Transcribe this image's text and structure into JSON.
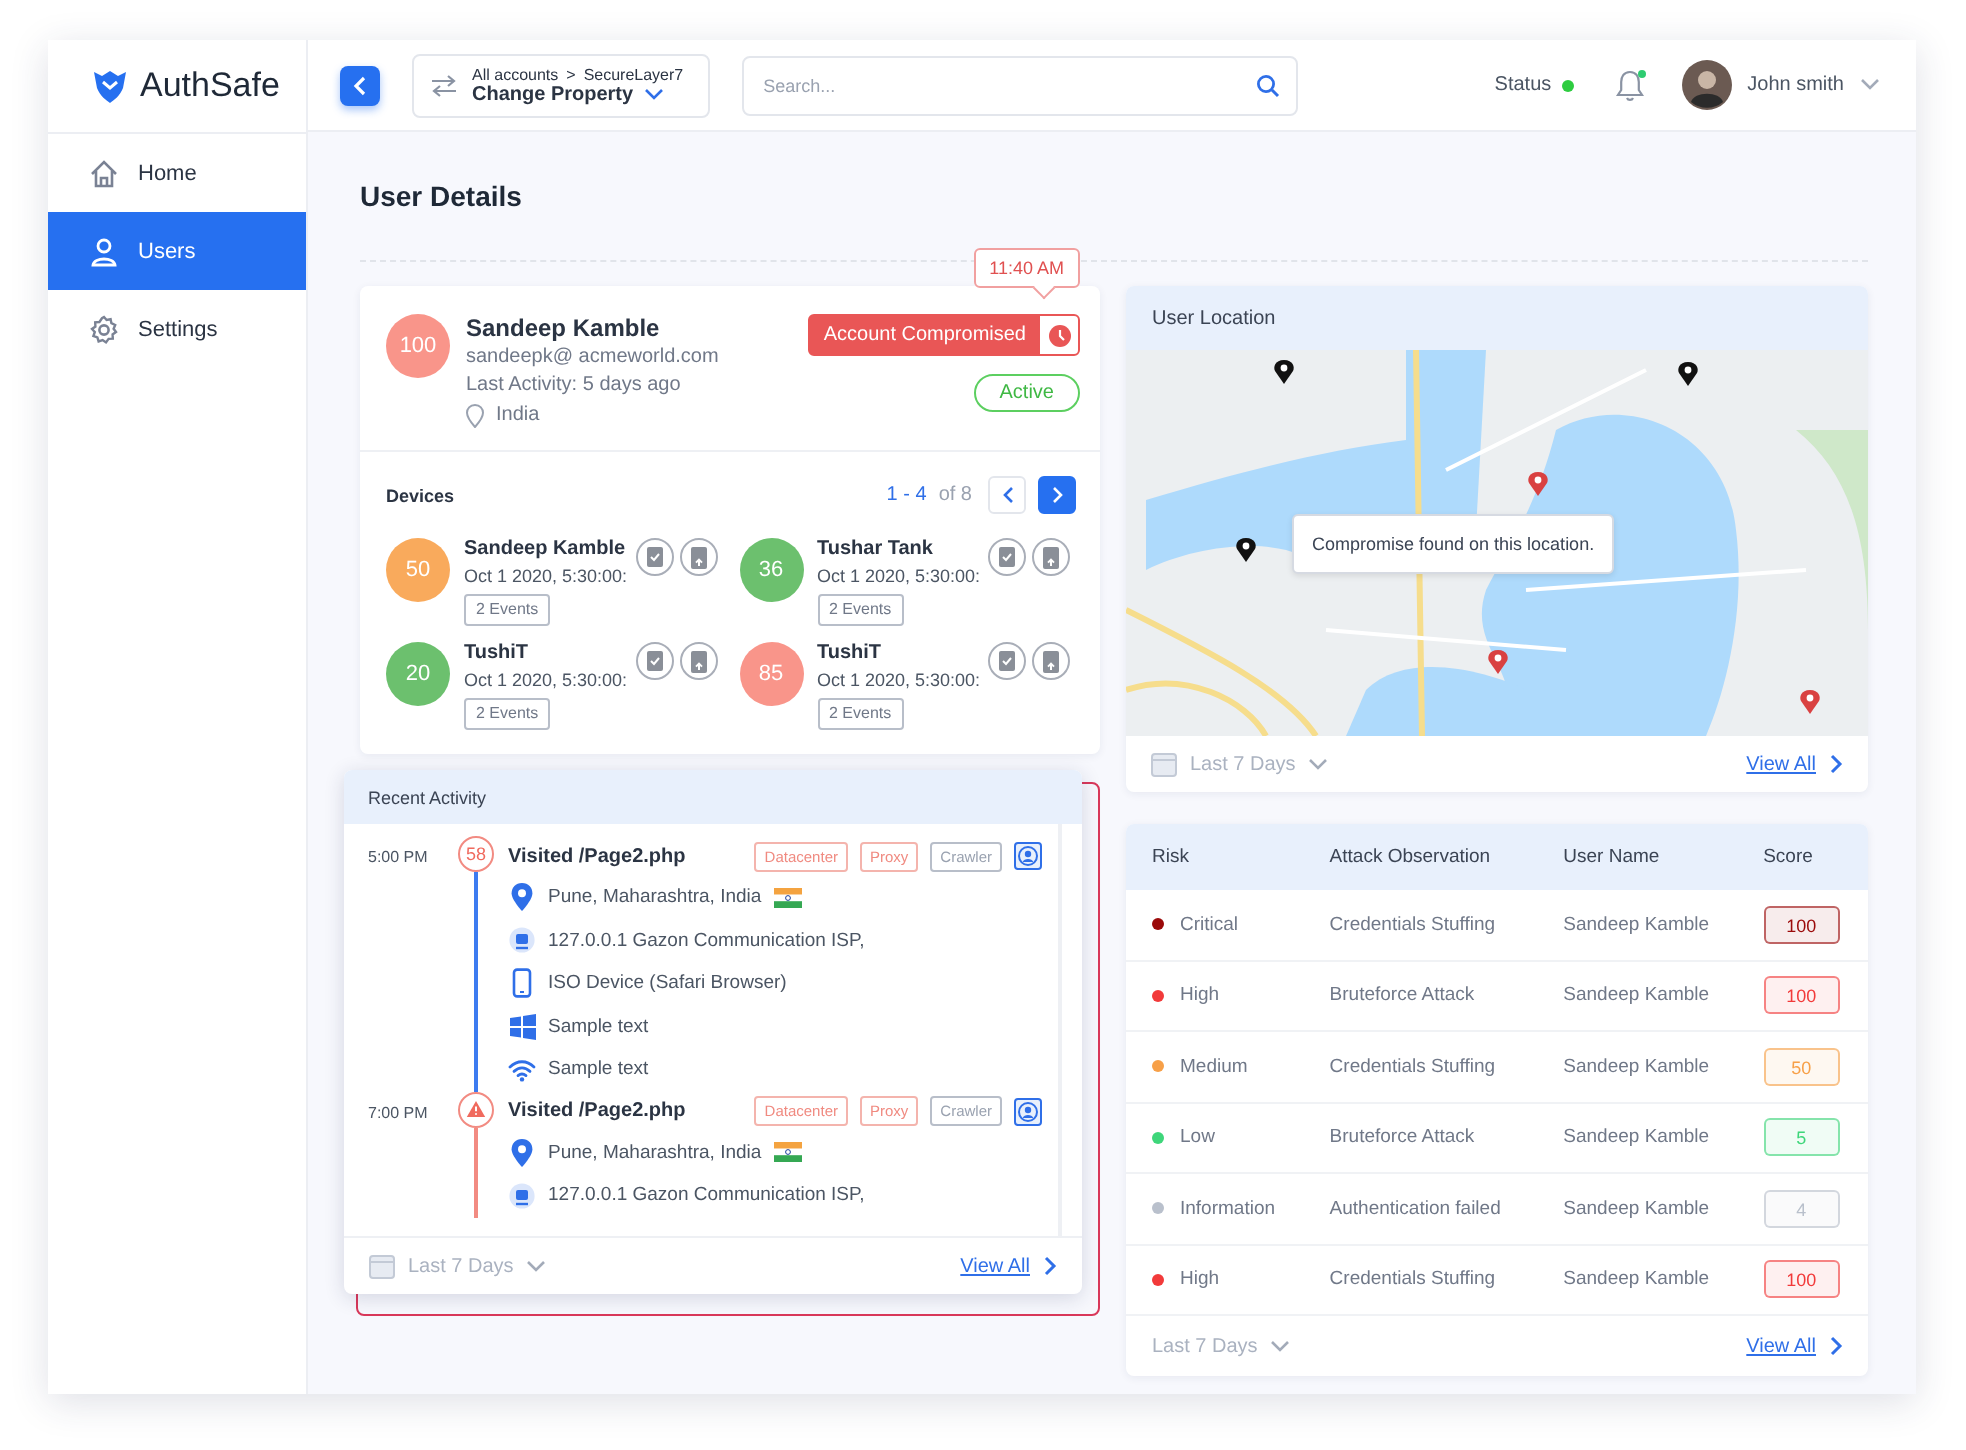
{
  "brand": {
    "name": "AuthSafe"
  },
  "sidebar": {
    "items": [
      {
        "label": "Home",
        "kind": "home",
        "selected": false
      },
      {
        "label": "Users",
        "kind": "user",
        "selected": true
      },
      {
        "label": "Settings",
        "kind": "settings",
        "selected": false
      }
    ]
  },
  "header": {
    "breadcrumb": {
      "parent": "All accounts",
      "separator": ">",
      "child": "SecureLayer7",
      "current": "Change Property"
    },
    "search": {
      "placeholder": "Search..."
    },
    "status": {
      "label": "Status",
      "online": true
    },
    "notifications": {
      "unread": true
    },
    "user": {
      "name": "John smith"
    }
  },
  "page_title": "User Details",
  "user_card": {
    "score": "100",
    "color": "#f9958a",
    "name": "Sandeep Kamble",
    "email": "sandeepk@ acmeworld.com",
    "last_activity": "Last Activity: 5 days ago",
    "country": "India",
    "alert": "Account Compromised",
    "alert_time": "11:40 AM",
    "status": "Active"
  },
  "devices": {
    "title": "Devices",
    "range": "1 - 4",
    "total": "of 8",
    "items": [
      {
        "score": "50",
        "color": "#f9aa5c",
        "name": "Sandeep Kamble",
        "time": "Oct 1 2020, 5:30:00:",
        "events": "2 Events"
      },
      {
        "score": "36",
        "color": "#6cc06e",
        "name": "Tushar Tank",
        "time": "Oct 1 2020, 5:30:00:",
        "events": "2 Events"
      },
      {
        "score": "20",
        "color": "#6cc06e",
        "name": "TushiT",
        "time": "Oct 1 2020, 5:30:00:",
        "events": "2 Events"
      },
      {
        "score": "85",
        "color": "#f9958a",
        "name": "TushiT",
        "time": "Oct 1 2020, 5:30:00:",
        "events": "2 Events"
      }
    ]
  },
  "location": {
    "title": "User Location",
    "tooltip": "Compromise found on this location.",
    "filter": "Last 7 Days",
    "link": "View All"
  },
  "activity": {
    "title": "Recent Activity",
    "filter": "Last 7 Days",
    "link": "View All",
    "events": [
      {
        "time": "5:00 PM",
        "kind": "score",
        "badge": "58",
        "title": "Visited /Page2.php",
        "tags": [
          {
            "label": "Datacenter",
            "kind": "alert"
          },
          {
            "label": "Proxy",
            "kind": "alert"
          },
          {
            "label": "Crawler",
            "kind": "neutral"
          }
        ],
        "details": [
          {
            "kind": "location",
            "text": "Pune, Maharashtra, India",
            "flag": true
          },
          {
            "kind": "isp",
            "text": "127.0.0.1 Gazon Communication ISP,",
            "flag": false
          },
          {
            "kind": "device",
            "text": "ISO Device (Safari Browser)",
            "flag": false
          },
          {
            "kind": "os",
            "text": "Sample text",
            "flag": false
          },
          {
            "kind": "wifi",
            "text": "Sample text",
            "flag": false
          }
        ]
      },
      {
        "time": "7:00 PM",
        "kind": "warning",
        "title": "Visited /Page2.php",
        "tags": [
          {
            "label": "Datacenter",
            "kind": "alert"
          },
          {
            "label": "Proxy",
            "kind": "alert"
          },
          {
            "label": "Crawler",
            "kind": "neutral"
          }
        ],
        "details": [
          {
            "kind": "location",
            "text": "Pune, Maharashtra, India",
            "flag": true
          },
          {
            "kind": "isp",
            "text": "127.0.0.1 Gazon Communication ISP,",
            "flag": false
          }
        ]
      }
    ]
  },
  "risk_table": {
    "columns": [
      "Risk",
      "Attack Observation",
      "User Name",
      "Score"
    ],
    "filter": "Last 7 Days",
    "link": "View All",
    "rows": [
      {
        "risk": "Critical",
        "color": "#9b0a0a",
        "observation": "Credentials Stuffing",
        "user": "Sandeep Kamble",
        "score": "100"
      },
      {
        "risk": "High",
        "color": "#f23a3a",
        "observation": "Bruteforce Attack",
        "user": "Sandeep Kamble",
        "score": "100"
      },
      {
        "risk": "Medium",
        "color": "#f7a048",
        "observation": "Credentials Stuffing",
        "user": "Sandeep Kamble",
        "score": "50"
      },
      {
        "risk": "Low",
        "color": "#3ed67a",
        "observation": "Bruteforce Attack",
        "user": "Sandeep Kamble",
        "score": "5"
      },
      {
        "risk": "Information",
        "color": "#b9c0cc",
        "observation": "Authentication failed",
        "user": "Sandeep Kamble",
        "score": "4"
      },
      {
        "risk": "High",
        "color": "#f23a3a",
        "observation": "Credentials Stuffing",
        "user": "Sandeep Kamble",
        "score": "100"
      }
    ]
  }
}
